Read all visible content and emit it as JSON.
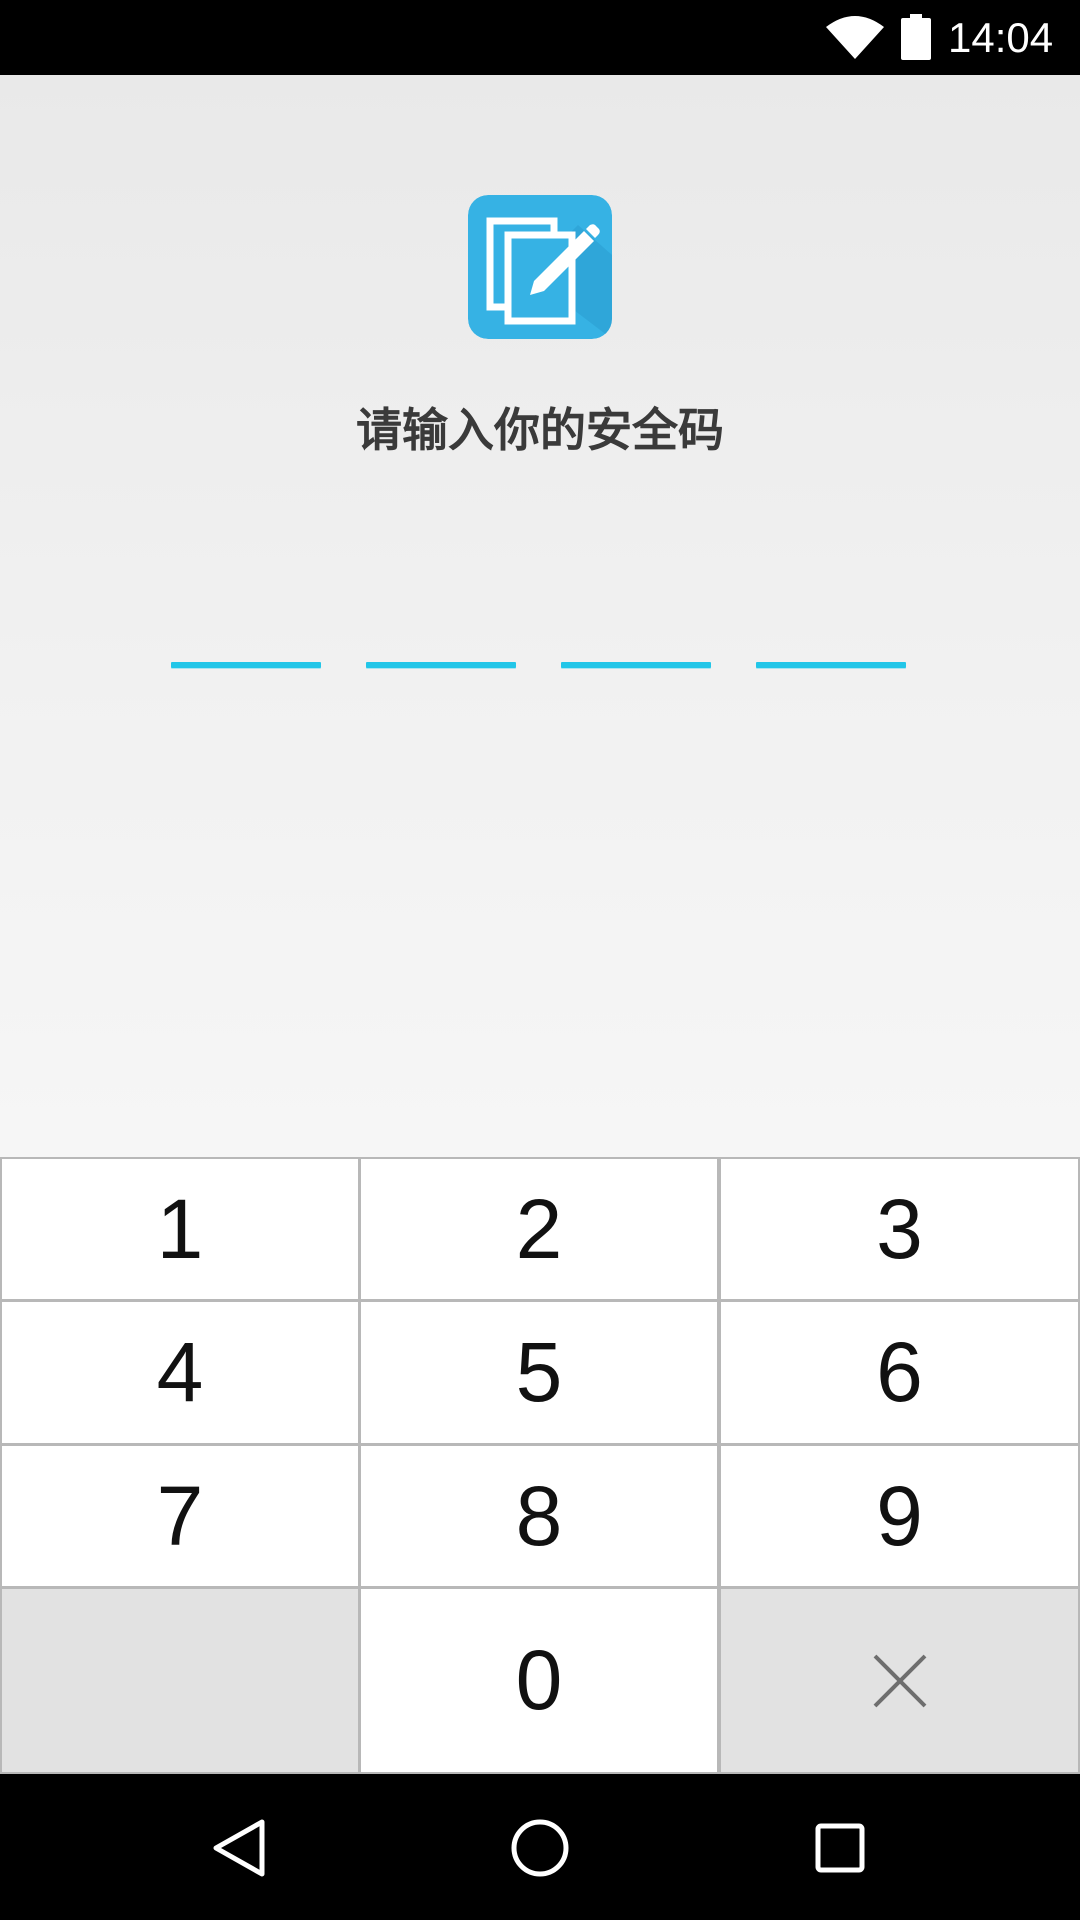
{
  "status_bar": {
    "time": "14:04",
    "wifi_icon": "wifi-icon",
    "battery_icon": "battery-icon"
  },
  "app_icon": "notepad-edit-icon",
  "colors": {
    "accent": "#22c6e8",
    "icon_blue": "#36b2e4",
    "prompt_text": "#3a3a3a"
  },
  "prompt": "请输入你的安全码",
  "pin_slots": 4,
  "keypad": {
    "keys": [
      "1",
      "2",
      "3",
      "4",
      "5",
      "6",
      "7",
      "8",
      "9",
      "",
      "0",
      "×"
    ],
    "delete_icon": "close-icon"
  },
  "nav_bar": {
    "back_icon": "back-triangle-icon",
    "home_icon": "home-circle-icon",
    "recents_icon": "recents-square-icon"
  }
}
